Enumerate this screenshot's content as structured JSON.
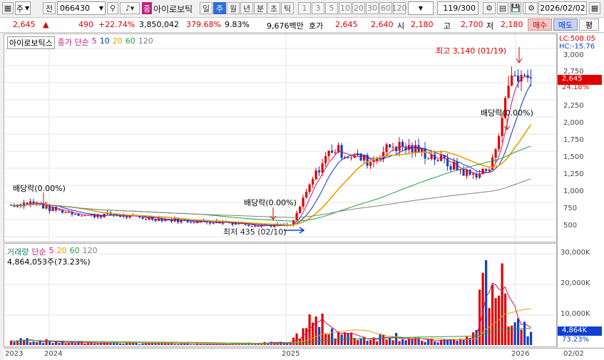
{
  "toolbar": {
    "market_select": "주",
    "prev_label": "전",
    "code": "066430",
    "name_badge": "종",
    "stock_name": "아이로보틱",
    "period_buttons": [
      "일",
      "주",
      "월",
      "년",
      "분",
      "초",
      "틱"
    ],
    "period_selected": "주",
    "interval_buttons": [
      "1",
      "3",
      "5",
      "10",
      "20",
      "30",
      "60",
      "120"
    ],
    "count": "119/300",
    "date": "2026/02/02"
  },
  "quote": {
    "price": "2,645",
    "change": "490",
    "change_pct": "+22.74%",
    "volume": "3,850,042",
    "vol_ratio": "379.68%",
    "turnover": "9.83%",
    "amount": "9,676백만",
    "hoga_label": "호가",
    "ask": "2,645",
    "bid": "2,640",
    "open_label": "시",
    "open": "2,180",
    "high_label": "고",
    "high": "2,700",
    "low_label": "저",
    "low": "2,180",
    "buy_label": "매수",
    "sell_label": "매도",
    "eval_label": "평"
  },
  "legend": {
    "name": "아이로보틱스",
    "ma_label": "종가 단순",
    "ma5": "5",
    "ma10": "10",
    "ma20": "20",
    "ma60": "60",
    "ma120": "120",
    "vol_name": "거래량",
    "vol_ma_label": "단순",
    "vol_ma5": "5",
    "vol_ma20": "20",
    "vol_ma60": "60",
    "vol_ma120": "120",
    "vol_value": "4,864,053주(73.23%)"
  },
  "annotations": {
    "high": "최고 3,140 (01/19)",
    "low": "최저 435 (02/10)",
    "div1": "배당락(0.00%)",
    "div2": "배당락(0.00%)",
    "div3": "배당락(0.00%)"
  },
  "yaxis": {
    "lc": "LC:508.05",
    "hc": "HC:-15.76",
    "price_ticks": [
      "3,000",
      "2,750",
      "2,250",
      "2,000",
      "1,750",
      "1,500",
      "1,250",
      "1,000",
      "750",
      "500"
    ],
    "current_price": "2,645",
    "current_pct": "24.18%",
    "vol_ticks": [
      "30,000K",
      "20,000K",
      "10,000K"
    ],
    "current_vol": "4,864K",
    "current_vol_pct": "73.23%"
  },
  "xaxis": {
    "labels": [
      "2023",
      "2024",
      "2025",
      "2026",
      "02/02"
    ]
  },
  "colors": {
    "up": "#e00000",
    "down": "#1040d0",
    "ma5": "#d01070",
    "ma10": "#1030c0",
    "ma20": "#e8a000",
    "ma60": "#20a040",
    "ma120": "#808080"
  },
  "chart_data": {
    "type": "candlestick",
    "title": "아이로보틱스",
    "ylim": [
      300,
      3150
    ],
    "x": [
      "2023-12",
      "2024-01",
      "2024-02",
      "2024-03",
      "2024-04",
      "2024-05",
      "2024-06",
      "2024-07",
      "2024-08",
      "2024-09",
      "2024-10",
      "2024-11",
      "2024-12",
      "2025-01",
      "2025-02",
      "2025-03",
      "2025-04",
      "2025-05",
      "2025-06",
      "2025-07",
      "2025-08",
      "2025-09",
      "2025-10",
      "2025-11",
      "2025-12",
      "2026-01",
      "2026-02"
    ],
    "close": [
      760,
      800,
      700,
      650,
      600,
      620,
      580,
      560,
      540,
      520,
      510,
      500,
      470,
      460,
      450,
      1100,
      1600,
      1500,
      1400,
      1650,
      1600,
      1500,
      1350,
      1200,
      1300,
      2700,
      2645
    ],
    "volume_k": [
      1500,
      2000,
      1200,
      900,
      800,
      1000,
      700,
      600,
      600,
      500,
      400,
      500,
      600,
      800,
      700,
      9000,
      6000,
      3000,
      2500,
      4000,
      2000,
      1500,
      1800,
      2500,
      28000,
      12000,
      4864
    ]
  }
}
